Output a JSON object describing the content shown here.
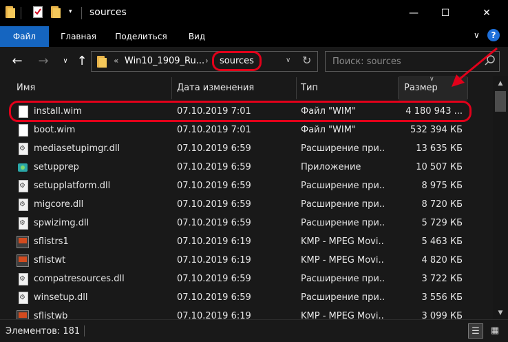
{
  "window": {
    "title": "sources",
    "minimize": "—",
    "maximize": "☐",
    "close": "✕"
  },
  "ribbon": {
    "tabs": [
      {
        "label": "Файл"
      },
      {
        "label": "Главная"
      },
      {
        "label": "Поделиться"
      },
      {
        "label": "Вид"
      }
    ]
  },
  "address": {
    "crumbs": [
      "Win10_1909_Ru...",
      "sources"
    ],
    "search_placeholder": "Поиск: sources"
  },
  "columns": {
    "name": "Имя",
    "date": "Дата изменения",
    "type": "Тип",
    "size": "Размер"
  },
  "files": [
    {
      "name": "install.wim",
      "date": "07.10.2019 7:01",
      "type": "Файл \"WIM\"",
      "size": "4 180 943 ...",
      "icon": "file-icon"
    },
    {
      "name": "boot.wim",
      "date": "07.10.2019 7:01",
      "type": "Файл \"WIM\"",
      "size": "532 394 КБ",
      "icon": "file-icon"
    },
    {
      "name": "mediasetupimgr.dll",
      "date": "07.10.2019 6:59",
      "type": "Расширение при...",
      "size": "13 635 КБ",
      "icon": "dll-icon"
    },
    {
      "name": "setupprep",
      "date": "07.10.2019 6:59",
      "type": "Приложение",
      "size": "10 507 КБ",
      "icon": "app-icon"
    },
    {
      "name": "setupplatform.dll",
      "date": "07.10.2019 6:59",
      "type": "Расширение при...",
      "size": "8 975 КБ",
      "icon": "dll-icon"
    },
    {
      "name": "migcore.dll",
      "date": "07.10.2019 6:59",
      "type": "Расширение при...",
      "size": "8 720 КБ",
      "icon": "dll-icon"
    },
    {
      "name": "spwizimg.dll",
      "date": "07.10.2019 6:59",
      "type": "Расширение при...",
      "size": "5 729 КБ",
      "icon": "dll-icon"
    },
    {
      "name": "sflistrs1",
      "date": "07.10.2019 6:19",
      "type": "KMP - MPEG Movi...",
      "size": "5 463 КБ",
      "icon": "movie-icon"
    },
    {
      "name": "sflistwt",
      "date": "07.10.2019 6:19",
      "type": "KMP - MPEG Movi...",
      "size": "4 820 КБ",
      "icon": "movie-icon"
    },
    {
      "name": "compatresources.dll",
      "date": "07.10.2019 6:59",
      "type": "Расширение при...",
      "size": "3 722 КБ",
      "icon": "dll-icon"
    },
    {
      "name": "winsetup.dll",
      "date": "07.10.2019 6:59",
      "type": "Расширение при...",
      "size": "3 556 КБ",
      "icon": "dll-icon"
    },
    {
      "name": "sflistwb",
      "date": "07.10.2019 6:19",
      "type": "KMP - MPEG Movi...",
      "size": "3 099 КБ",
      "icon": "movie-icon"
    }
  ],
  "status": {
    "items_count": "Элементов: 181"
  },
  "colors": {
    "accent": "#1565c0",
    "annotation": "#e2001a"
  }
}
